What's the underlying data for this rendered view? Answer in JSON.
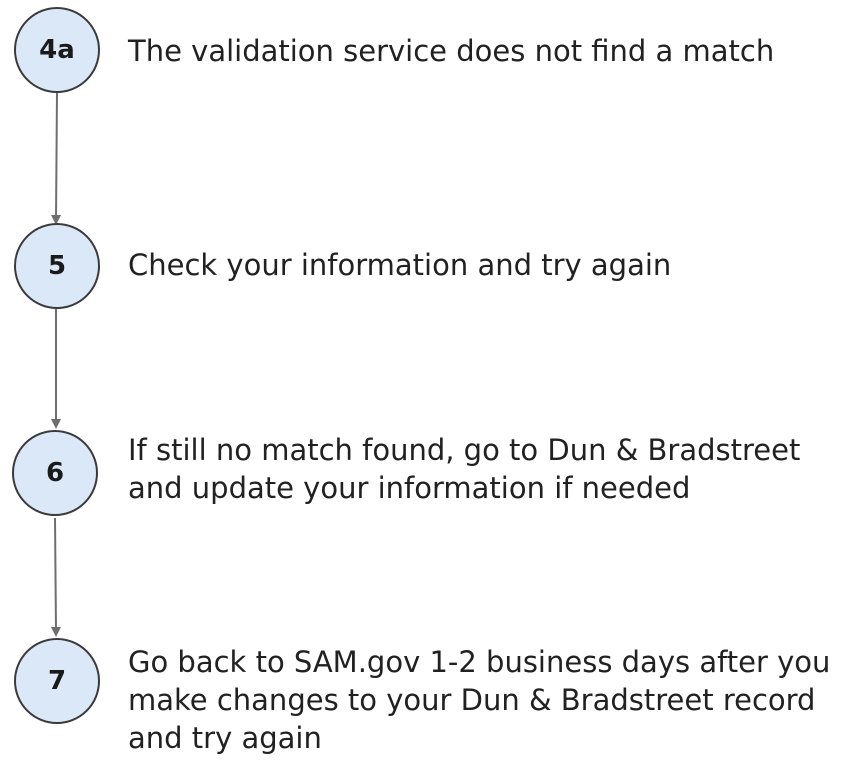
{
  "steps": [
    {
      "number": "4a",
      "lines": [
        "The validation service does not find a match"
      ]
    },
    {
      "number": "5",
      "lines": [
        "Check your information and try again"
      ]
    },
    {
      "number": "6",
      "lines": [
        "If still no match found, go to Dun & Bradstreet",
        "and update your information if needed"
      ]
    },
    {
      "number": "7",
      "lines": [
        "Go back to SAM.gov 1-2 business days after you",
        "make changes to your Dun & Bradstreet record",
        "and try again"
      ]
    }
  ],
  "colors": {
    "circle_fill": "#dbe8f7",
    "circle_border": "#3a3a3a",
    "connector": "#6e6e6e",
    "text": "#212121"
  }
}
